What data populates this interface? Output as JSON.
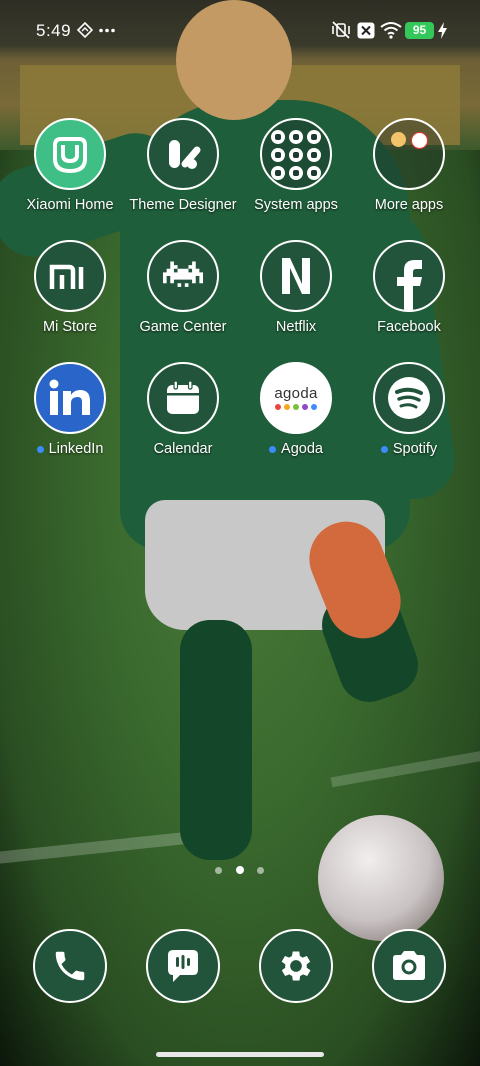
{
  "status_bar": {
    "time": "5:49",
    "battery_level": "95",
    "icons": [
      "navigation-diamond-icon",
      "more-dots-icon",
      "mute-vibrate-icon",
      "sim-x-icon",
      "wifi-icon",
      "battery-icon",
      "charging-bolt-icon"
    ]
  },
  "apps": [
    {
      "name": "Xiaomi Home",
      "icon": "xiaomi-home-icon",
      "dot": false
    },
    {
      "name": "Theme Designer",
      "icon": "theme-designer-icon",
      "dot": false
    },
    {
      "name": "System apps",
      "icon": "system-apps-folder-icon",
      "dot": false
    },
    {
      "name": "More apps",
      "icon": "more-apps-folder-icon",
      "dot": false
    },
    {
      "name": "Mi Store",
      "icon": "mi-store-icon",
      "dot": false
    },
    {
      "name": "Game Center",
      "icon": "game-center-icon",
      "dot": false
    },
    {
      "name": "Netflix",
      "icon": "netflix-icon",
      "dot": false
    },
    {
      "name": "Facebook",
      "icon": "facebook-icon",
      "dot": false
    },
    {
      "name": "LinkedIn",
      "icon": "linkedin-icon",
      "dot": true
    },
    {
      "name": "Calendar",
      "icon": "calendar-icon",
      "dot": false
    },
    {
      "name": "Agoda",
      "icon": "agoda-icon",
      "dot": true
    },
    {
      "name": "Spotify",
      "icon": "spotify-icon",
      "dot": true
    }
  ],
  "agoda_logo_text": "agoda",
  "mi_logo_text": "mi",
  "dock": [
    "phone-icon",
    "messages-icon",
    "settings-icon",
    "camera-icon"
  ],
  "pager": {
    "pages": 3,
    "active": 2
  },
  "colors": {
    "icon_bg": "#22543c",
    "badge_dot": "#3d8bff",
    "battery": "#34c759",
    "linkedin": "#2a66c9"
  }
}
